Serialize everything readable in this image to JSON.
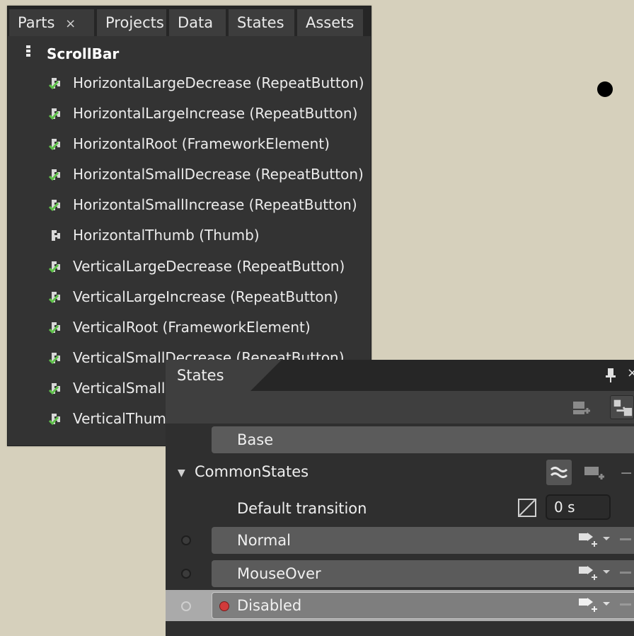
{
  "parts_panel": {
    "tabs": [
      {
        "label": "Parts",
        "close": "×"
      },
      {
        "label": "Projects"
      },
      {
        "label": "Data"
      },
      {
        "label": "States"
      },
      {
        "label": "Assets"
      }
    ],
    "root": "ScrollBar",
    "items": [
      "HorizontalLargeDecrease (RepeatButton)",
      "HorizontalLargeIncrease (RepeatButton)",
      "HorizontalRoot (FrameworkElement)",
      "HorizontalSmallDecrease (RepeatButton)",
      "HorizontalSmallIncrease (RepeatButton)",
      "HorizontalThumb (Thumb)",
      "VerticalLargeDecrease (RepeatButton)",
      "VerticalLargeIncrease (RepeatButton)",
      "VerticalRoot (FrameworkElement)",
      "VerticalSmallDecrease (RepeatButton)",
      "VerticalSmallIncrease (RepeatButton)",
      "VerticalThumb (Thumb)"
    ]
  },
  "states_panel": {
    "title": "States",
    "base_label": "Base",
    "group_label": "CommonStates",
    "default_transition_label": "Default transition",
    "default_transition_value": "0 s",
    "states": [
      "Normal",
      "MouseOver",
      "Disabled"
    ],
    "selected_state": "Disabled"
  },
  "colors": {
    "background": "#d6d0bc",
    "panel": "#333333",
    "recording": "#d23b3b",
    "check_green": "#5fc04a"
  }
}
